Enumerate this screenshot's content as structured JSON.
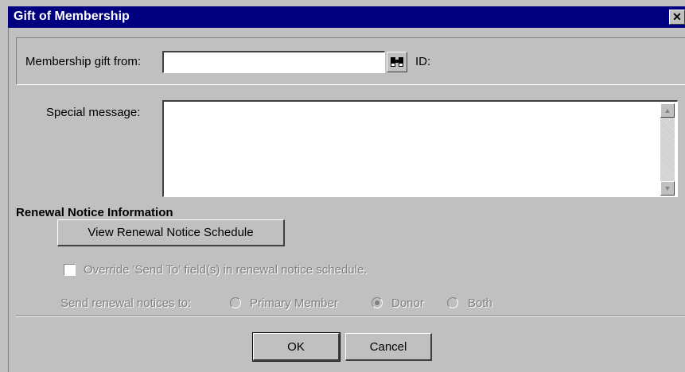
{
  "window": {
    "title": "Gift of Membership",
    "close_glyph": "✕",
    "close_icon": "close-icon"
  },
  "gift_from": {
    "label": "Membership gift from:",
    "value": "",
    "id_label": "ID:",
    "lookup_icon": "binoculars-icon"
  },
  "special_message": {
    "label": "Special message:",
    "value": ""
  },
  "renewal": {
    "heading": "Renewal Notice Information",
    "view_schedule_label": "View Renewal Notice Schedule",
    "override_label": "Override 'Send To' field(s) in renewal notice schedule.",
    "override_checked": false,
    "send_to_label": "Send renewal notices to:",
    "options": [
      "Primary Member",
      "Donor",
      "Both"
    ],
    "selected": "Donor"
  },
  "buttons": {
    "ok": "OK",
    "cancel": "Cancel"
  }
}
